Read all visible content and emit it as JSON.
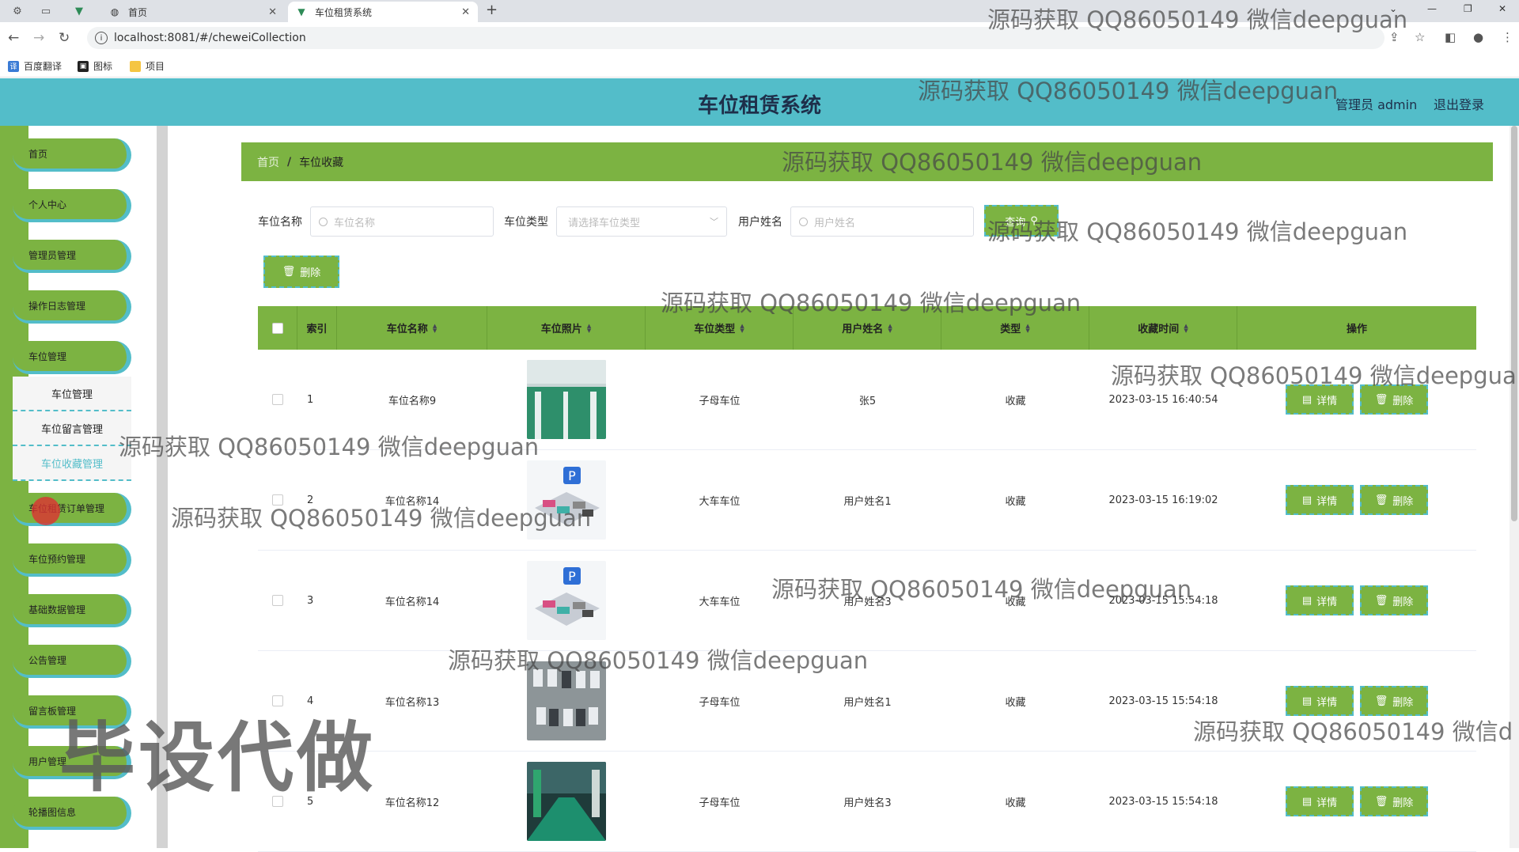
{
  "browser": {
    "tabs": [
      {
        "title": "首页",
        "active": false
      },
      {
        "title": "车位租赁系统",
        "active": true
      }
    ],
    "url": "localhost:8081/#/cheweiCollection",
    "bookmarks": [
      "百度翻译",
      "图标",
      "项目"
    ]
  },
  "header": {
    "title": "车位租赁系统",
    "admin": "管理员 admin",
    "logout": "退出登录"
  },
  "sidebar": {
    "items": [
      {
        "label": "首页"
      },
      {
        "label": "个人中心"
      },
      {
        "label": "管理员管理"
      },
      {
        "label": "操作日志管理"
      },
      {
        "label": "车位管理"
      },
      {
        "label": "车位租赁订单管理"
      },
      {
        "label": "车位预约管理"
      },
      {
        "label": "基础数据管理"
      },
      {
        "label": "公告管理"
      },
      {
        "label": "留言板管理"
      },
      {
        "label": "用户管理"
      },
      {
        "label": "轮播图信息"
      }
    ],
    "submenu": [
      {
        "label": "车位管理"
      },
      {
        "label": "车位留言管理"
      },
      {
        "label": "车位收藏管理",
        "active": true
      }
    ]
  },
  "breadcrumb": {
    "home": "首页",
    "separator": "/",
    "current": "车位收藏"
  },
  "search": {
    "name_label": "车位名称",
    "name_placeholder": "车位名称",
    "type_label": "车位类型",
    "type_placeholder": "请选择车位类型",
    "user_label": "用户姓名",
    "user_placeholder": "用户姓名",
    "query_button": "查询"
  },
  "toolbar": {
    "delete_button": "删除"
  },
  "table": {
    "headers": [
      "索引",
      "车位名称",
      "车位照片",
      "车位类型",
      "用户姓名",
      "类型",
      "收藏时间",
      "操作"
    ],
    "rows": [
      {
        "index": "1",
        "name": "车位名称9",
        "type": "子母车位",
        "user": "张5",
        "kind": "收藏",
        "time": "2023-03-15 16:40:54",
        "photo": "garage"
      },
      {
        "index": "2",
        "name": "车位名称14",
        "type": "大车车位",
        "user": "用户姓名1",
        "kind": "收藏",
        "time": "2023-03-15 16:19:02",
        "photo": "parking-iso"
      },
      {
        "index": "3",
        "name": "车位名称14",
        "type": "大车车位",
        "user": "用户姓名3",
        "kind": "收藏",
        "time": "2023-03-15 15:54:18",
        "photo": "parking-iso"
      },
      {
        "index": "4",
        "name": "车位名称13",
        "type": "子母车位",
        "user": "用户姓名1",
        "kind": "收藏",
        "time": "2023-03-15 15:54:18",
        "photo": "aerial"
      },
      {
        "index": "5",
        "name": "车位名称12",
        "type": "子母车位",
        "user": "用户姓名3",
        "kind": "收藏",
        "time": "2023-03-15 15:54:18",
        "photo": "garage-dark"
      }
    ],
    "detail_button": "详情",
    "delete_button": "删除"
  },
  "watermarks": {
    "text": "源码获取 QQ86050149 微信deepguan",
    "text_cut1": "源码获取 QQ86050149 微信deepgua",
    "text_cut2": "源码获取 QQ86050149 微信d",
    "big": "毕设代做"
  },
  "colors": {
    "header": "#53bdc9",
    "accent_green": "#7cb342",
    "dash": "#53bdc9"
  }
}
